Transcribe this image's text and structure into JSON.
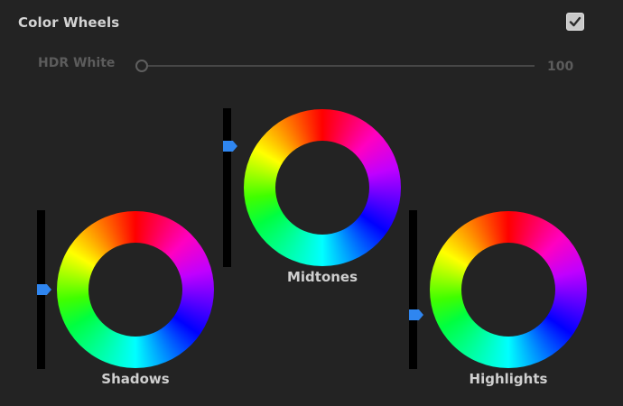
{
  "panel": {
    "title": "Color Wheels",
    "enabled": true
  },
  "hdr_white": {
    "label": "HDR White",
    "value": "100",
    "slider_fraction": 0.0
  },
  "wheels": [
    {
      "id": "shadows",
      "label": "Shadows",
      "luminance_fraction": 0.5
    },
    {
      "id": "midtones",
      "label": "Midtones",
      "luminance_fraction": 0.78
    },
    {
      "id": "highlights",
      "label": "Highlights",
      "luminance_fraction": 0.33
    }
  ],
  "colors": {
    "background": "#232323",
    "accent": "#2f86f0"
  }
}
